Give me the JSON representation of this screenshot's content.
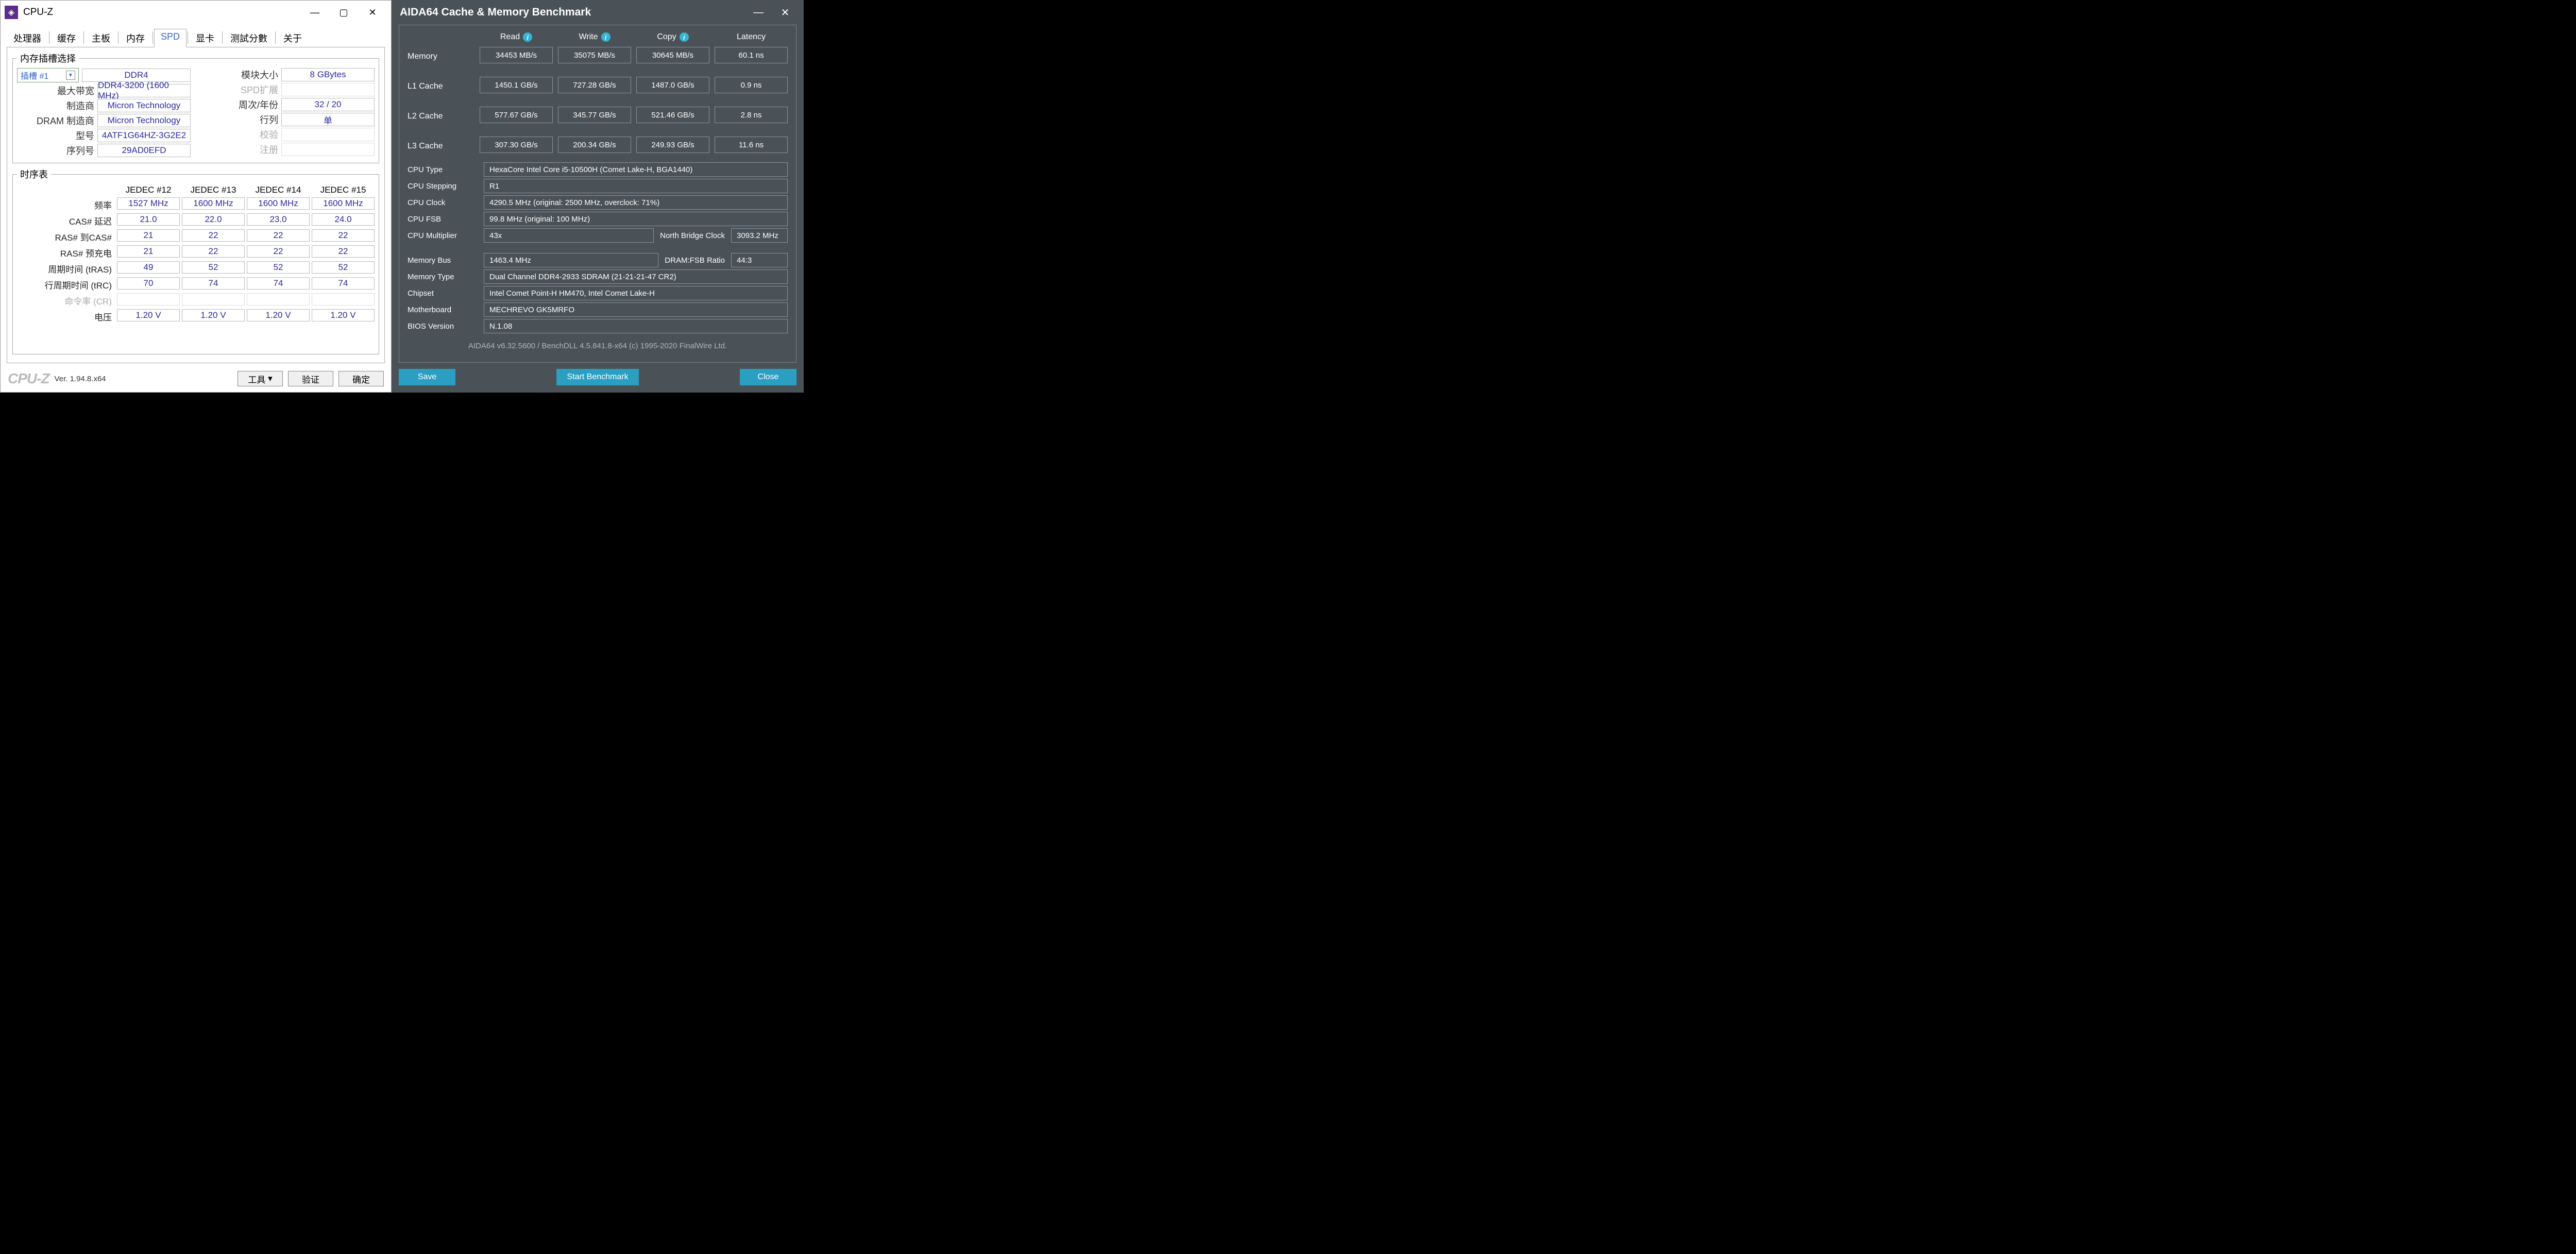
{
  "cpuz": {
    "window_title": "CPU-Z",
    "tabs": [
      "处理器",
      "缓存",
      "主板",
      "内存",
      "SPD",
      "显卡",
      "测試分數",
      "关于"
    ],
    "active_tab_index": 4,
    "slot_group_label": "内存插槽选择",
    "slot_selected": "插槽 #1",
    "left_fields": [
      {
        "label": "",
        "value": "DDR4"
      },
      {
        "label": "最大带宽",
        "value": "DDR4-3200 (1600 MHz)"
      },
      {
        "label": "制造商",
        "value": "Micron Technology"
      },
      {
        "label": "DRAM 制造商",
        "value": "Micron Technology"
      },
      {
        "label": "型号",
        "value": "4ATF1G64HZ-3G2E2"
      },
      {
        "label": "序列号",
        "value": "29AD0EFD"
      }
    ],
    "right_fields": [
      {
        "label": "模块大小",
        "value": "8 GBytes"
      },
      {
        "label": "SPD扩展",
        "value": "",
        "disabled": true
      },
      {
        "label": "周次/年份",
        "value": "32 / 20"
      },
      {
        "label": "行列",
        "value": "单"
      },
      {
        "label": "校验",
        "value": "",
        "disabled": true
      },
      {
        "label": "注册",
        "value": "",
        "disabled": true
      }
    ],
    "timing_group_label": "时序表",
    "timing_headers": [
      "JEDEC #12",
      "JEDEC #13",
      "JEDEC #14",
      "JEDEC #15"
    ],
    "timing_rows": [
      {
        "label": "频率",
        "cells": [
          "1527 MHz",
          "1600 MHz",
          "1600 MHz",
          "1600 MHz"
        ]
      },
      {
        "label": "CAS# 延迟",
        "cells": [
          "21.0",
          "22.0",
          "23.0",
          "24.0"
        ]
      },
      {
        "label": "RAS# 到CAS#",
        "cells": [
          "21",
          "22",
          "22",
          "22"
        ]
      },
      {
        "label": "RAS# 预充电",
        "cells": [
          "21",
          "22",
          "22",
          "22"
        ]
      },
      {
        "label": "周期时间 (tRAS)",
        "cells": [
          "49",
          "52",
          "52",
          "52"
        ]
      },
      {
        "label": "行周期时间 (tRC)",
        "cells": [
          "70",
          "74",
          "74",
          "74"
        ]
      },
      {
        "label": "命令率 (CR)",
        "cells": [
          "",
          "",
          "",
          ""
        ],
        "disabled": true
      },
      {
        "label": "电压",
        "cells": [
          "1.20 V",
          "1.20 V",
          "1.20 V",
          "1.20 V"
        ]
      }
    ],
    "footer": {
      "logo": "CPU-Z",
      "version": "Ver. 1.94.8.x64",
      "tools_btn": "工具",
      "validate_btn": "验证",
      "ok_btn": "确定"
    }
  },
  "aida": {
    "window_title": "AIDA64 Cache & Memory Benchmark",
    "col_headers": [
      "Read",
      "Write",
      "Copy",
      "Latency"
    ],
    "bench_rows": [
      {
        "label": "Memory",
        "cells": [
          "34453 MB/s",
          "35075 MB/s",
          "30645 MB/s",
          "60.1 ns"
        ]
      },
      {
        "label": "L1 Cache",
        "cells": [
          "1450.1 GB/s",
          "727.28 GB/s",
          "1487.0 GB/s",
          "0.9 ns"
        ]
      },
      {
        "label": "L2 Cache",
        "cells": [
          "577.67 GB/s",
          "345.77 GB/s",
          "521.46 GB/s",
          "2.8 ns"
        ]
      },
      {
        "label": "L3 Cache",
        "cells": [
          "307.30 GB/s",
          "200.34 GB/s",
          "249.93 GB/s",
          "11.6 ns"
        ]
      }
    ],
    "cpu_info": {
      "cpu_type": {
        "label": "CPU Type",
        "value": "HexaCore Intel Core i5-10500H  (Comet Lake-H, BGA1440)"
      },
      "cpu_stepping": {
        "label": "CPU Stepping",
        "value": "R1"
      },
      "cpu_clock": {
        "label": "CPU Clock",
        "value": "4290.5 MHz  (original: 2500 MHz, overclock: 71%)"
      },
      "cpu_fsb": {
        "label": "CPU FSB",
        "value": "99.8 MHz  (original: 100 MHz)"
      },
      "cpu_mult": {
        "label": "CPU Multiplier",
        "value": "43x",
        "side_label": "North Bridge Clock",
        "side_value": "3093.2 MHz"
      },
      "mem_bus": {
        "label": "Memory Bus",
        "value": "1463.4 MHz",
        "side_label": "DRAM:FSB Ratio",
        "side_value": "44:3"
      },
      "mem_type": {
        "label": "Memory Type",
        "value": "Dual Channel DDR4-2933 SDRAM  (21-21-21-47 CR2)"
      },
      "chipset": {
        "label": "Chipset",
        "value": "Intel Comet Point-H HM470, Intel Comet Lake-H"
      },
      "motherboard": {
        "label": "Motherboard",
        "value": "MECHREVO GK5MRFO"
      },
      "bios": {
        "label": "BIOS Version",
        "value": "N.1.08"
      }
    },
    "copyright": "AIDA64 v6.32.5600 / BenchDLL 4.5.841.8-x64  (c) 1995-2020 FinalWire Ltd.",
    "buttons": {
      "save": "Save",
      "start": "Start Benchmark",
      "close": "Close"
    }
  }
}
